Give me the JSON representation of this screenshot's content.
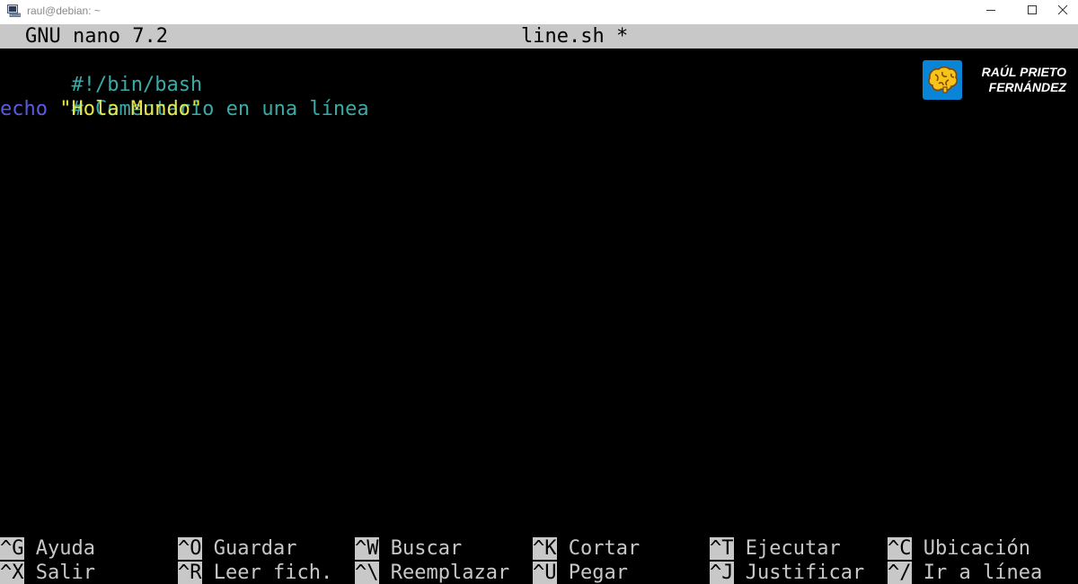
{
  "window": {
    "title": "raul@debian: ~"
  },
  "nano": {
    "version": "GNU nano 7.2",
    "filename": "line.sh *"
  },
  "code": {
    "line1": "#!/bin/bash",
    "line2": "# Comentario en una línea",
    "line3_keyword": "echo",
    "line3_string": "\"Hola Mundo\""
  },
  "logo": {
    "line1": "RAÚL PRIETO",
    "line2": "FERNÁNDEZ"
  },
  "shortcuts": {
    "row1": [
      {
        "key": "^G",
        "label": "Ayuda"
      },
      {
        "key": "^O",
        "label": "Guardar"
      },
      {
        "key": "^W",
        "label": "Buscar"
      },
      {
        "key": "^K",
        "label": "Cortar"
      },
      {
        "key": "^T",
        "label": "Ejecutar"
      },
      {
        "key": "^C",
        "label": "Ubicación"
      }
    ],
    "row2": [
      {
        "key": "^X",
        "label": "Salir"
      },
      {
        "key": "^R",
        "label": "Leer fich."
      },
      {
        "key": "^\\",
        "label": "Reemplazar"
      },
      {
        "key": "^U",
        "label": "Pegar"
      },
      {
        "key": "^J",
        "label": "Justificar"
      },
      {
        "key": "^/",
        "label": "Ir a línea"
      }
    ]
  },
  "colors": {
    "header_bg": "#c8c8c8",
    "comment": "#3aaaa6",
    "keyword": "#5a5ae6",
    "string": "#e6e64a",
    "logo_badge": "#0a84d6"
  }
}
